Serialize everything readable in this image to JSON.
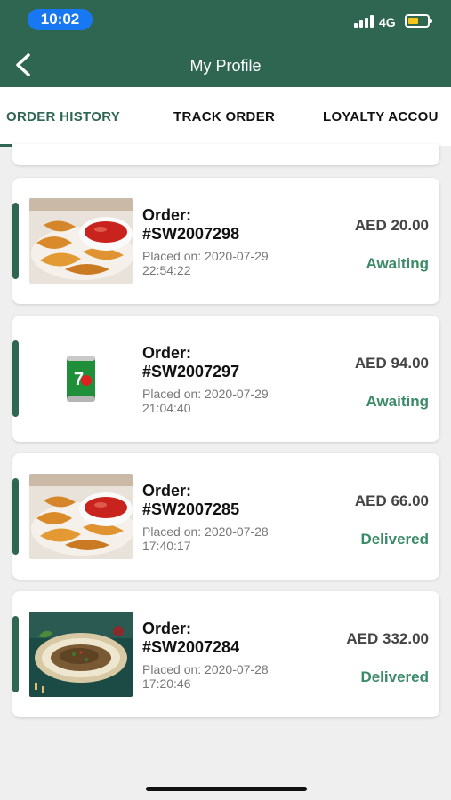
{
  "status_bar": {
    "time": "10:02",
    "network": "4G"
  },
  "header": {
    "title": "My Profile"
  },
  "tabs": [
    {
      "label": "ORDER HISTORY"
    },
    {
      "label": "TRACK ORDER"
    },
    {
      "label": "LOYALTY ACCOU"
    }
  ],
  "orders": [
    {
      "order_label": "Order:",
      "order_id": "#SW2007298",
      "placed_label": "Placed on: 2020-07-29",
      "placed_time": "22:54:22",
      "price": "AED 20.00",
      "status": "Awaiting",
      "thumb": "potato-wedges-image"
    },
    {
      "order_label": "Order:",
      "order_id": "#SW2007297",
      "placed_label": "Placed on: 2020-07-29",
      "placed_time": "21:04:40",
      "price": "AED 94.00",
      "status": "Awaiting",
      "thumb": "7up-can-image"
    },
    {
      "order_label": "Order:",
      "order_id": "#SW2007285",
      "placed_label": "Placed on: 2020-07-28",
      "placed_time": "17:40:17",
      "price": "AED 66.00",
      "status": "Delivered",
      "thumb": "potato-wedges-image"
    },
    {
      "order_label": "Order:",
      "order_id": "#SW2007284",
      "placed_label": "Placed on: 2020-07-28",
      "placed_time": "17:20:46",
      "price": "AED 332.00",
      "status": "Delivered",
      "thumb": "meat-platter-image"
    }
  ],
  "colors": {
    "primary": "#2f6651",
    "status_green": "#3a8a68",
    "background": "#efefef"
  }
}
